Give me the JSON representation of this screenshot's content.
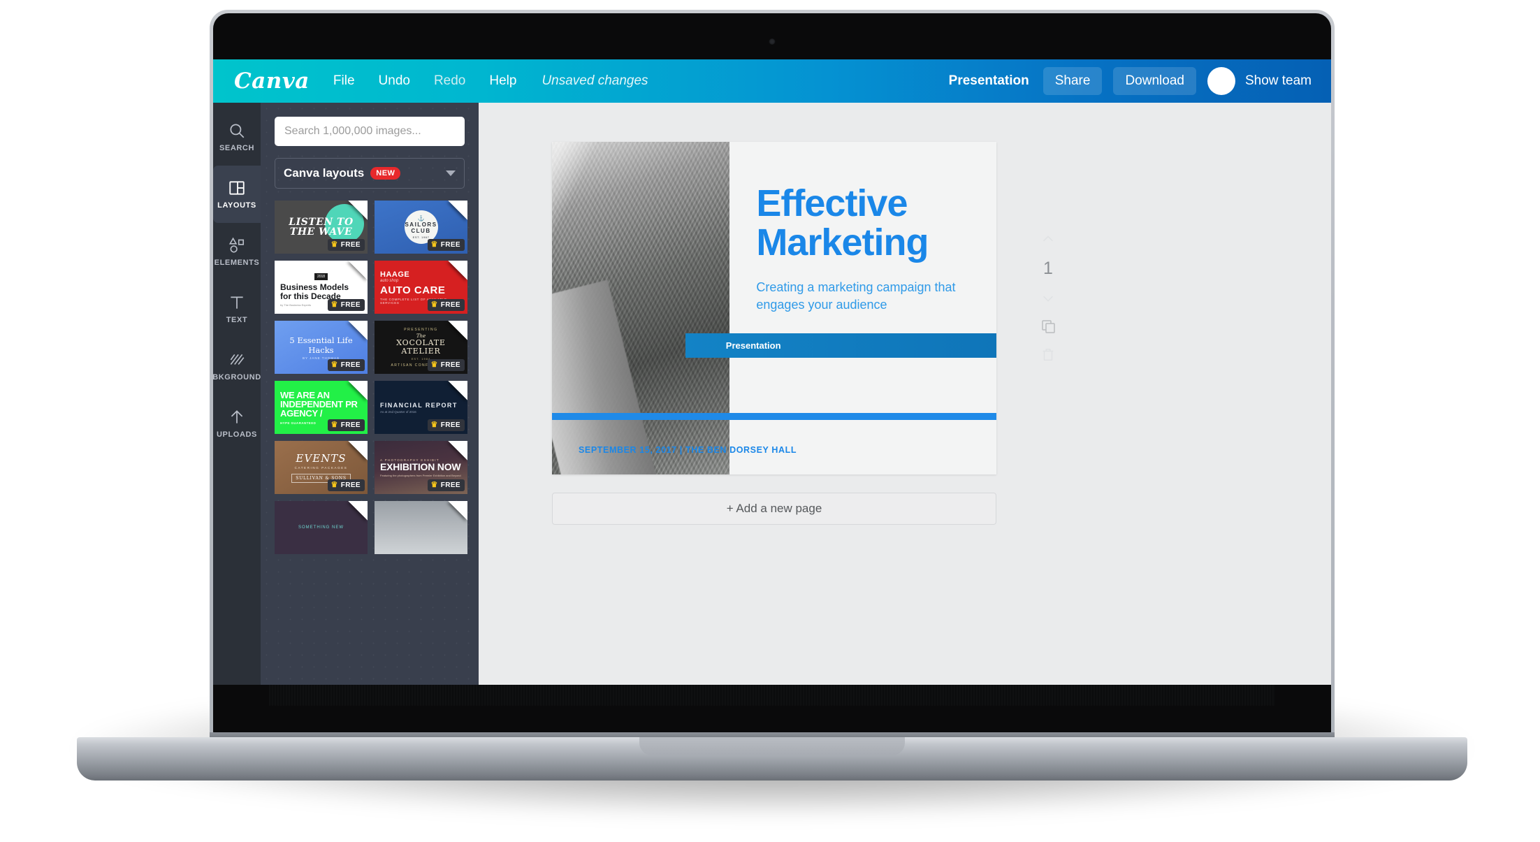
{
  "topbar": {
    "logo": "Canva",
    "menu": [
      {
        "label": "File",
        "dim": false
      },
      {
        "label": "Undo",
        "dim": false
      },
      {
        "label": "Redo",
        "dim": true
      },
      {
        "label": "Help",
        "dim": false
      }
    ],
    "status": "Unsaved changes",
    "doc_title": "Presentation",
    "share_label": "Share",
    "download_label": "Download",
    "show_team_label": "Show team",
    "colors": {
      "gradient_start": "#00c4cc",
      "gradient_end": "#0560b4"
    }
  },
  "rail": {
    "items": [
      {
        "label": "SEARCH",
        "icon": "search-icon",
        "active": false
      },
      {
        "label": "LAYOUTS",
        "icon": "layouts-icon",
        "active": true
      },
      {
        "label": "ELEMENTS",
        "icon": "elements-icon",
        "active": false
      },
      {
        "label": "TEXT",
        "icon": "text-icon",
        "active": false
      },
      {
        "label": "BKGROUND",
        "icon": "background-icon",
        "active": false
      },
      {
        "label": "UPLOADS",
        "icon": "upload-icon",
        "active": false
      }
    ]
  },
  "panel": {
    "search_placeholder": "Search 1,000,000 images...",
    "search_value": "",
    "category_label": "Canva layouts",
    "category_badge": "NEW",
    "badge_color": "#e8292c",
    "free_tag": "FREE",
    "thumbnails": [
      {
        "style": "t1",
        "title": "LISTEN TO THE WAVE",
        "free": true
      },
      {
        "style": "t2",
        "title": "SAILORS CLUB",
        "est": "EST. 1967",
        "free": true
      },
      {
        "style": "t3",
        "tag": "2018",
        "title": "Business Models for this Decade",
        "sub": "by The Business Experts",
        "free": true
      },
      {
        "style": "t4",
        "brand": "HAAGE",
        "brand_sub": "auto shop",
        "title": "AUTO CARE",
        "sub": "THE COMPLETE LIST OF AVAILABLE SERVICES",
        "free": true
      },
      {
        "style": "t5",
        "title": "5 Essential Life Hacks",
        "sub": "BY JANE THOMAS",
        "free": true
      },
      {
        "style": "t6",
        "pre": "PRESENTING",
        "the": "The",
        "title": "XOCOLATE ATELIER",
        "est": "EST. 1984",
        "sub": "ARTISAN CONFECTIONS",
        "free": true
      },
      {
        "style": "t7",
        "title": "WE ARE AN INDEPENDENT PR AGENCY /",
        "sub": "HYPE GUARANTEED",
        "free": true
      },
      {
        "style": "t8",
        "title": "FINANCIAL REPORT",
        "sub": "As at 2nd Quarter of 2016",
        "free": true
      },
      {
        "style": "t9",
        "title": "EVENTS",
        "sub": "CATERING PACKAGES",
        "box": "SULLIVAN & SONS",
        "free": true
      },
      {
        "style": "t10",
        "pre": "A PHOTOGRAPHY EXHIBIT",
        "title": "EXHIBITION NOW",
        "sub": "Featuring the photographers from Premier Exhibition and Beyond",
        "free": true
      },
      {
        "style": "t11",
        "title": "SOMETHING NEW",
        "free": false
      },
      {
        "style": "t12",
        "title": "",
        "free": false
      }
    ]
  },
  "canvas": {
    "slide": {
      "tag": "Presentation",
      "title": "Effective Marketing",
      "subtitle": "Creating a marketing campaign that engages your audience",
      "footer": "SEPTEMBER 15, 2017  |  THE BEN DORSEY HALL",
      "accent_color": "#1a87e8"
    },
    "page_tools": {
      "move_up": "arrow-up-icon",
      "page_number": "1",
      "move_down": "arrow-down-icon",
      "duplicate": "duplicate-icon",
      "delete": "trash-icon"
    },
    "add_page_label": "+ Add a new page"
  }
}
